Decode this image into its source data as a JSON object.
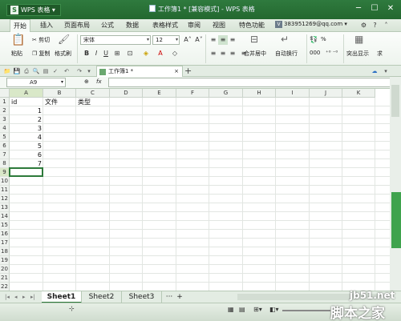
{
  "titlebar": {
    "app_button": "WPS 表格",
    "app_logo": "S",
    "title": "工作簿1 * [兼容模式] - WPS 表格"
  },
  "menu": {
    "tabs": [
      "开始",
      "插入",
      "页面布局",
      "公式",
      "数据",
      "表格样式",
      "审阅",
      "视图",
      "特色功能"
    ],
    "account_badge": "V",
    "account": "383951269@qq.com"
  },
  "ribbon": {
    "paste": "粘贴",
    "cut": "剪切",
    "copy": "复制",
    "format_painter": "格式刷",
    "font_name": "宋体",
    "font_size": "12",
    "merge_center": "合并居中",
    "wrap_text": "自动换行",
    "highlight": "突出显示",
    "percent": "%",
    "thousands": "000",
    "more": "求"
  },
  "doc_tab": {
    "label": "工作簿1 *",
    "add": "+"
  },
  "formula_bar": {
    "name_box": "A9",
    "fx": "fx",
    "zoom": "⊕",
    "value": ""
  },
  "grid": {
    "columns": [
      "A",
      "B",
      "C",
      "D",
      "E",
      "F",
      "G",
      "H",
      "I",
      "J",
      "K"
    ],
    "rows": [
      "1",
      "2",
      "3",
      "4",
      "5",
      "6",
      "7",
      "8",
      "9",
      "10",
      "11",
      "12",
      "13",
      "14",
      "15",
      "16",
      "17",
      "18",
      "19",
      "20",
      "21",
      "22"
    ],
    "selected_column": "A",
    "selected_row": "9",
    "cells": [
      {
        "col": 0,
        "row": 0,
        "text": "id",
        "align": "left"
      },
      {
        "col": 1,
        "row": 0,
        "text": "文件",
        "align": "left"
      },
      {
        "col": 2,
        "row": 0,
        "text": "类型",
        "align": "left"
      },
      {
        "col": 0,
        "row": 1,
        "text": "1",
        "align": "right"
      },
      {
        "col": 0,
        "row": 2,
        "text": "2",
        "align": "right"
      },
      {
        "col": 0,
        "row": 3,
        "text": "3",
        "align": "right"
      },
      {
        "col": 0,
        "row": 4,
        "text": "4",
        "align": "right"
      },
      {
        "col": 0,
        "row": 5,
        "text": "5",
        "align": "right"
      },
      {
        "col": 0,
        "row": 6,
        "text": "6",
        "align": "right"
      },
      {
        "col": 0,
        "row": 7,
        "text": "7",
        "align": "right"
      }
    ]
  },
  "sheets": {
    "tabs": [
      "Sheet1",
      "Sheet2",
      "Sheet3"
    ],
    "active": "Sheet1",
    "more": "···",
    "add": "+"
  },
  "watermark": {
    "site": "jb51.net",
    "name": "脚本之家"
  }
}
